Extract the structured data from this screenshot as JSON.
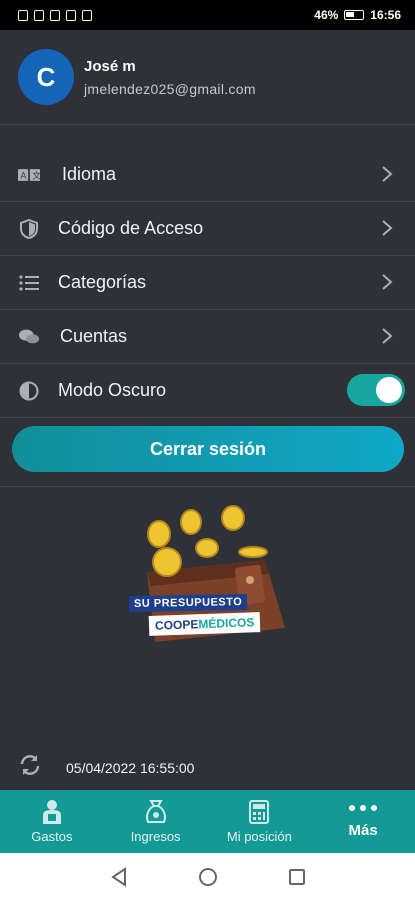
{
  "status_bar": {
    "battery": "46%",
    "time": "16:56"
  },
  "profile": {
    "initial": "C",
    "name": "José m",
    "email": "jmelendez025@gmail.com"
  },
  "menu": {
    "items": [
      {
        "label": "Idioma",
        "icon": "language-icon"
      },
      {
        "label": "Código de Acceso",
        "icon": "shield-icon"
      },
      {
        "label": "Categorías",
        "icon": "list-icon"
      },
      {
        "label": "Cuentas",
        "icon": "chat-bubbles-icon"
      }
    ],
    "dark_mode": {
      "label": "Modo Oscuro",
      "enabled": true
    }
  },
  "logout_label": "Cerrar sesión",
  "illustration": {
    "line1": "SU PRESUPUESTO",
    "brand_a": "COOPE",
    "brand_b": "MÉDICOS"
  },
  "sync": {
    "timestamp": "05/04/2022 16:55:00"
  },
  "tabs": [
    {
      "label": "Gastos",
      "icon": "person-expense-icon"
    },
    {
      "label": "Ingresos",
      "icon": "money-bag-icon"
    },
    {
      "label": "Mi posición",
      "icon": "calculator-icon"
    },
    {
      "label": "Más",
      "icon": "more-dots-icon",
      "active": true
    }
  ],
  "colors": {
    "background": "#2e3138",
    "accent": "#149a96",
    "avatar": "#1565b8"
  }
}
